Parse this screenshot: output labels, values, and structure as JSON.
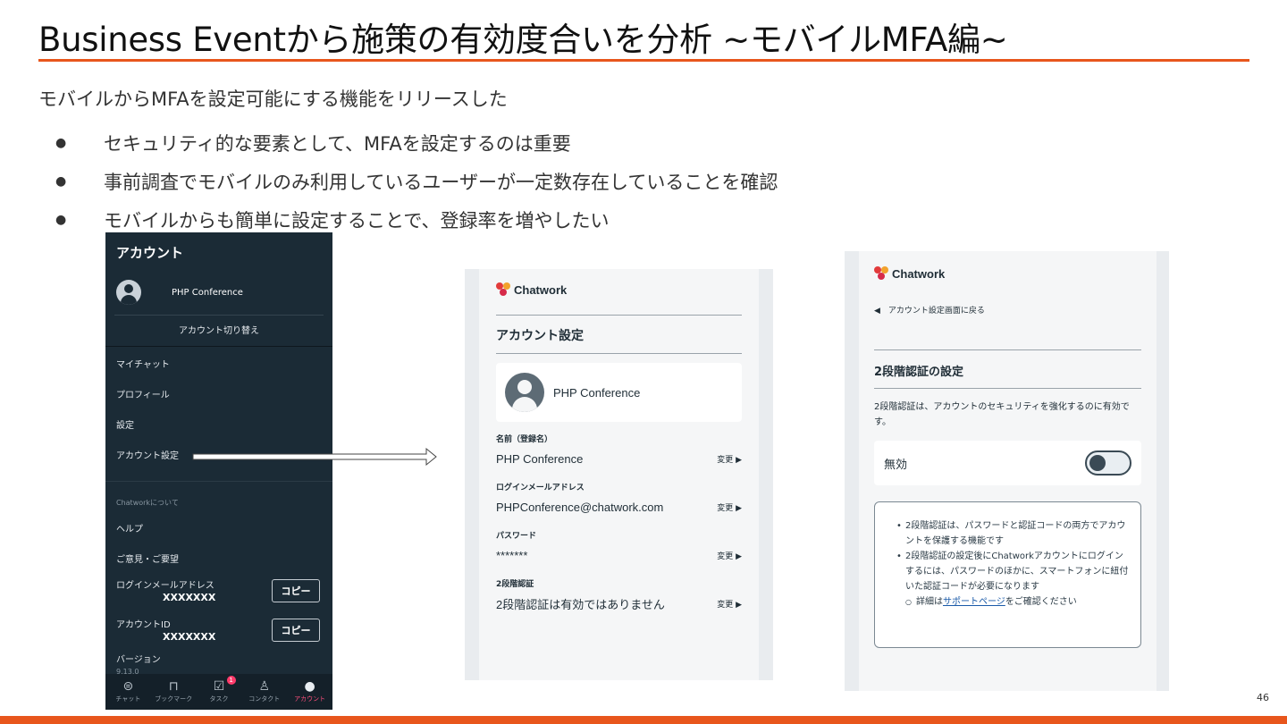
{
  "slide": {
    "title": "Business Eventから施策の有効度合いを分析 ~モバイルMFA編~",
    "lead": "モバイルからMFAを設定可能にする機能をリリースした",
    "bullets": [
      "セキュリティ的な要素として、MFAを設定するのは重要",
      "事前調査でモバイルのみ利用しているユーザーが一定数存在していることを確認",
      "モバイルからも簡単に設定することで、登録率を増やしたい"
    ],
    "bullet_glyph": "●",
    "page_number": "46",
    "accent_color": "#e8561c"
  },
  "phone_menu": {
    "header": "アカウント",
    "user_name": "PHP Conference",
    "switch_account": "アカウント切り替え",
    "items": [
      "マイチャット",
      "プロフィール",
      "設定",
      "アカウント設定"
    ],
    "about_label": "Chatworkについて",
    "items2": [
      "ヘルプ",
      "ご意見・ご要望"
    ],
    "login_email_label": "ログインメールアドレス",
    "login_email_value": "XXXXXXX",
    "account_id_label": "アカウントID",
    "account_id_value": "XXXXXXX",
    "copy_label": "コピー",
    "version_label": "バージョン",
    "version_value": "9.13.0",
    "tabs": [
      {
        "label": "チャット",
        "icon": "chat-icon",
        "glyph": "⊜"
      },
      {
        "label": "ブックマーク",
        "icon": "bookmark-icon",
        "glyph": "⊓"
      },
      {
        "label": "タスク",
        "icon": "task-icon",
        "glyph": "☑",
        "badge": "1"
      },
      {
        "label": "コンタクト",
        "icon": "contact-icon",
        "glyph": "♙"
      },
      {
        "label": "アカウント",
        "icon": "account-icon",
        "glyph": "●"
      }
    ]
  },
  "phone_settings": {
    "logo": "Chatwork",
    "heading": "アカウント設定",
    "user_name": "PHP Conference",
    "fields": [
      {
        "label": "名前（登録名）",
        "value": "PHP Conference",
        "action": "変更 ▶"
      },
      {
        "label": "ログインメールアドレス",
        "value": "PHPConference@chatwork.com",
        "action": "変更 ▶"
      },
      {
        "label": "パスワード",
        "value": "*******",
        "action": "変更 ▶"
      },
      {
        "label": "2段階認証",
        "value": "2段階認証は有効ではありません",
        "action": "変更 ▶"
      }
    ]
  },
  "phone_2fa": {
    "logo": "Chatwork",
    "back": "◀　アカウント設定画面に戻る",
    "heading": "2段階認証の設定",
    "description": "2段階認証は、アカウントのセキュリティを強化するのに有効です。",
    "toggle_label": "無効",
    "notes": [
      "2段階認証は、パスワードと認証コードの両方でアカウントを保護する機能です",
      "2段階認証の設定後にChatworkアカウントにログインするには、パスワードのほかに、スマートフォンに紐付いた認証コードが必要になります"
    ],
    "detail_prefix": "詳細は",
    "detail_link": "サポートページ",
    "detail_suffix": "をご確認ください"
  }
}
